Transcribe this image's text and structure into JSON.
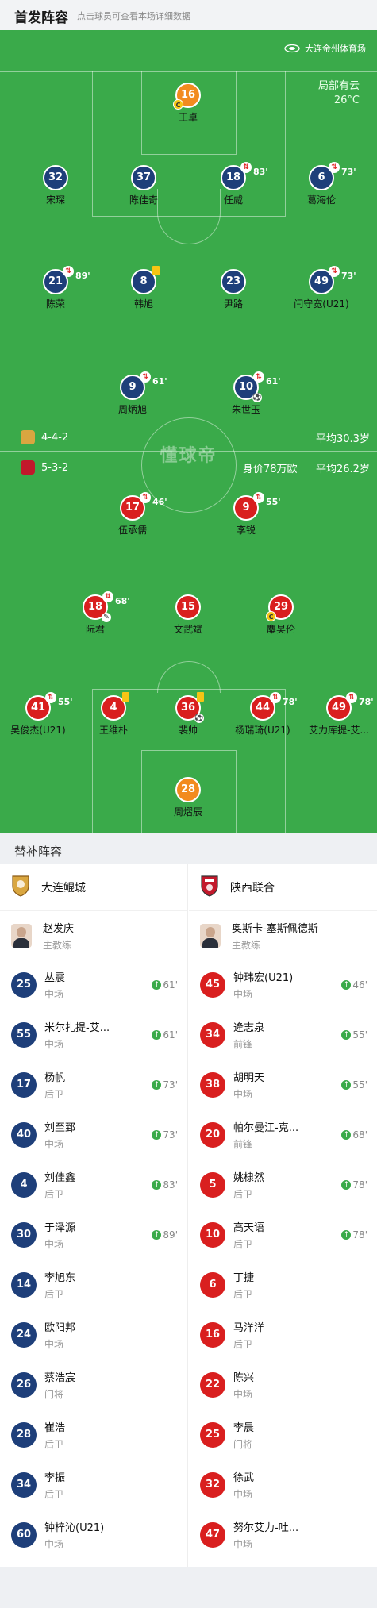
{
  "header": {
    "title": "首发阵容",
    "subtitle": "点击球员可查看本场详细数据"
  },
  "pitch": {
    "stadium": "大连金州体育场",
    "weather": "局部有云",
    "temperature": "26°C",
    "watermark": "懂球帝",
    "home_team": {
      "formation": "4-4-2",
      "avg_age": "平均30.3岁",
      "color": "#1e3f7a"
    },
    "away_team": {
      "formation": "5-3-2",
      "value": "身价78万欧",
      "avg_age": "平均26.2岁",
      "color": "#d91f1f"
    }
  },
  "home_players": [
    {
      "num": "16",
      "name": "王卓",
      "keeper": true,
      "captain": true
    },
    {
      "num": "32",
      "name": "宋琛"
    },
    {
      "num": "37",
      "name": "陈佳奇"
    },
    {
      "num": "18",
      "name": "任威",
      "sub": "83'"
    },
    {
      "num": "6",
      "name": "葛海伦",
      "sub": "73'"
    },
    {
      "num": "21",
      "name": "陈荣",
      "sub": "89'"
    },
    {
      "num": "8",
      "name": "韩旭",
      "yellow": true
    },
    {
      "num": "23",
      "name": "尹路"
    },
    {
      "num": "49",
      "name": "闫守宽(U21)",
      "sub": "73'"
    },
    {
      "num": "9",
      "name": "周炳旭",
      "sub": "61'"
    },
    {
      "num": "10",
      "name": "朱世玉",
      "sub": "61'",
      "goal": true
    }
  ],
  "away_players": [
    {
      "num": "17",
      "name": "伍承儒",
      "sub": "46'"
    },
    {
      "num": "9",
      "name": "李锐",
      "sub": "55'"
    },
    {
      "num": "18",
      "name": "阮君",
      "sub": "68'",
      "yellow": true,
      "assist": true
    },
    {
      "num": "15",
      "name": "文武斌"
    },
    {
      "num": "29",
      "name": "麋昊伦",
      "captain": true
    },
    {
      "num": "41",
      "name": "吴俊杰(U21)",
      "sub": "55'"
    },
    {
      "num": "4",
      "name": "王维朴",
      "yellow": true
    },
    {
      "num": "36",
      "name": "裴帅",
      "yellow": true,
      "goal": true
    },
    {
      "num": "44",
      "name": "杨瑞琦(U21)",
      "sub": "78'"
    },
    {
      "num": "49",
      "name": "艾力库提-艾...",
      "sub": "78'"
    },
    {
      "num": "28",
      "name": "周熠辰",
      "keeper": true
    }
  ],
  "bench_title": "替补阵容",
  "bench": {
    "home": {
      "team": "大连鲲城",
      "coach": {
        "name": "赵发庆",
        "role": "主教练"
      },
      "players": [
        {
          "num": "25",
          "name": "丛震",
          "pos": "中场",
          "in": "61'"
        },
        {
          "num": "55",
          "name": "米尔扎提-艾...",
          "pos": "中场",
          "in": "61'"
        },
        {
          "num": "17",
          "name": "杨帆",
          "pos": "后卫",
          "in": "73'"
        },
        {
          "num": "40",
          "name": "刘至郅",
          "pos": "中场",
          "in": "73'"
        },
        {
          "num": "4",
          "name": "刘佳鑫",
          "pos": "后卫",
          "in": "83'"
        },
        {
          "num": "30",
          "name": "于泽源",
          "pos": "中场",
          "in": "89'"
        },
        {
          "num": "14",
          "name": "李旭东",
          "pos": "后卫"
        },
        {
          "num": "24",
          "name": "欧阳邦",
          "pos": "中场"
        },
        {
          "num": "26",
          "name": "蔡浩宸",
          "pos": "门将"
        },
        {
          "num": "28",
          "name": "崔浩",
          "pos": "后卫"
        },
        {
          "num": "34",
          "name": "李振",
          "pos": "后卫"
        },
        {
          "num": "60",
          "name": "钟梓沁(U21)",
          "pos": "中场"
        }
      ]
    },
    "away": {
      "team": "陕西联合",
      "coach": {
        "name": "奥斯卡-塞斯佩德斯",
        "role": "主教练"
      },
      "players": [
        {
          "num": "45",
          "name": "钟玮宏(U21)",
          "pos": "中场",
          "in": "46'"
        },
        {
          "num": "34",
          "name": "逄志泉",
          "pos": "前锋",
          "in": "55'"
        },
        {
          "num": "38",
          "name": "胡明天",
          "pos": "中场",
          "in": "55'"
        },
        {
          "num": "20",
          "name": "帕尔曼江-克...",
          "pos": "前锋",
          "in": "68'"
        },
        {
          "num": "5",
          "name": "姚棣然",
          "pos": "后卫",
          "in": "78'"
        },
        {
          "num": "10",
          "name": "高天语",
          "pos": "后卫",
          "in": "78'"
        },
        {
          "num": "6",
          "name": "丁捷",
          "pos": "后卫"
        },
        {
          "num": "16",
          "name": "马洋洋",
          "pos": "后卫"
        },
        {
          "num": "22",
          "name": "陈兴",
          "pos": "中场"
        },
        {
          "num": "25",
          "name": "李晨",
          "pos": "门将"
        },
        {
          "num": "32",
          "name": "徐武",
          "pos": "中场"
        },
        {
          "num": "47",
          "name": "努尔艾力-吐...",
          "pos": "中场"
        }
      ]
    }
  }
}
